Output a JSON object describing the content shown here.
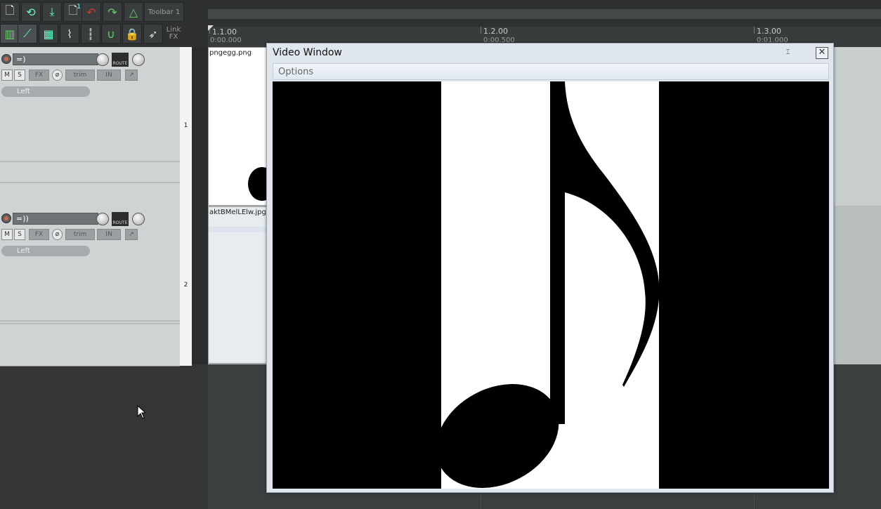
{
  "toolbar": {
    "label": "Toolbar 1",
    "link_fx": [
      "Link",
      "FX"
    ],
    "badge": "1"
  },
  "ruler": {
    "markers": [
      {
        "label": "1.1.00",
        "time": "0:00.000"
      },
      {
        "label": "1.2.00",
        "time": "0:00.500"
      },
      {
        "label": "1.3.00",
        "time": "0:01.000"
      }
    ]
  },
  "tracks": [
    {
      "number": "1",
      "name": "=)",
      "route": "ROUTE",
      "m": "M",
      "s": "S",
      "fx": "FX",
      "trim": "trim",
      "in": "IN",
      "envelope": "Left",
      "item_label": "pngegg.png"
    },
    {
      "number": "2",
      "name": "=))",
      "route": "ROUTE",
      "m": "M",
      "s": "S",
      "fx": "FX",
      "trim": "trim",
      "in": "IN",
      "envelope": "Left",
      "item_label": "aktBMelLElw.jpg"
    }
  ],
  "video_window": {
    "title": "Video Window",
    "menu_options": "Options",
    "close_symbol": "✕"
  }
}
